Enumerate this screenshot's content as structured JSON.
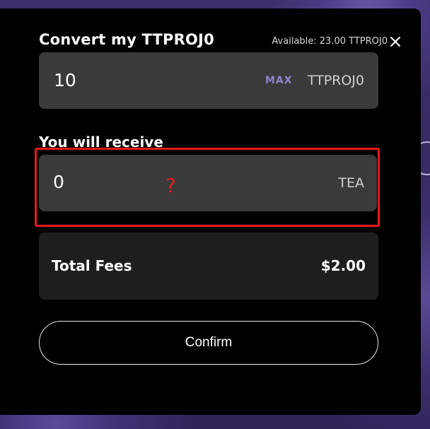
{
  "dialog": {
    "title": "Convert my TTPROJ0",
    "available": "Available: 23.00 TTPROJ0",
    "close_icon": "close-icon"
  },
  "convert_input": {
    "value": "10",
    "max_label": "MAX",
    "unit": "TTPROJ0"
  },
  "receive": {
    "label": "You will receive",
    "value": "0",
    "unit": "TEA",
    "annotation": "?"
  },
  "fees": {
    "label": "Total Fees",
    "amount": "$2.00"
  },
  "confirm_label": "Confirm",
  "colors": {
    "accent": "#8f84cf",
    "highlight": "#e81a1a",
    "panel": "#3a3a3a",
    "fees_panel": "#1e1e1e"
  }
}
